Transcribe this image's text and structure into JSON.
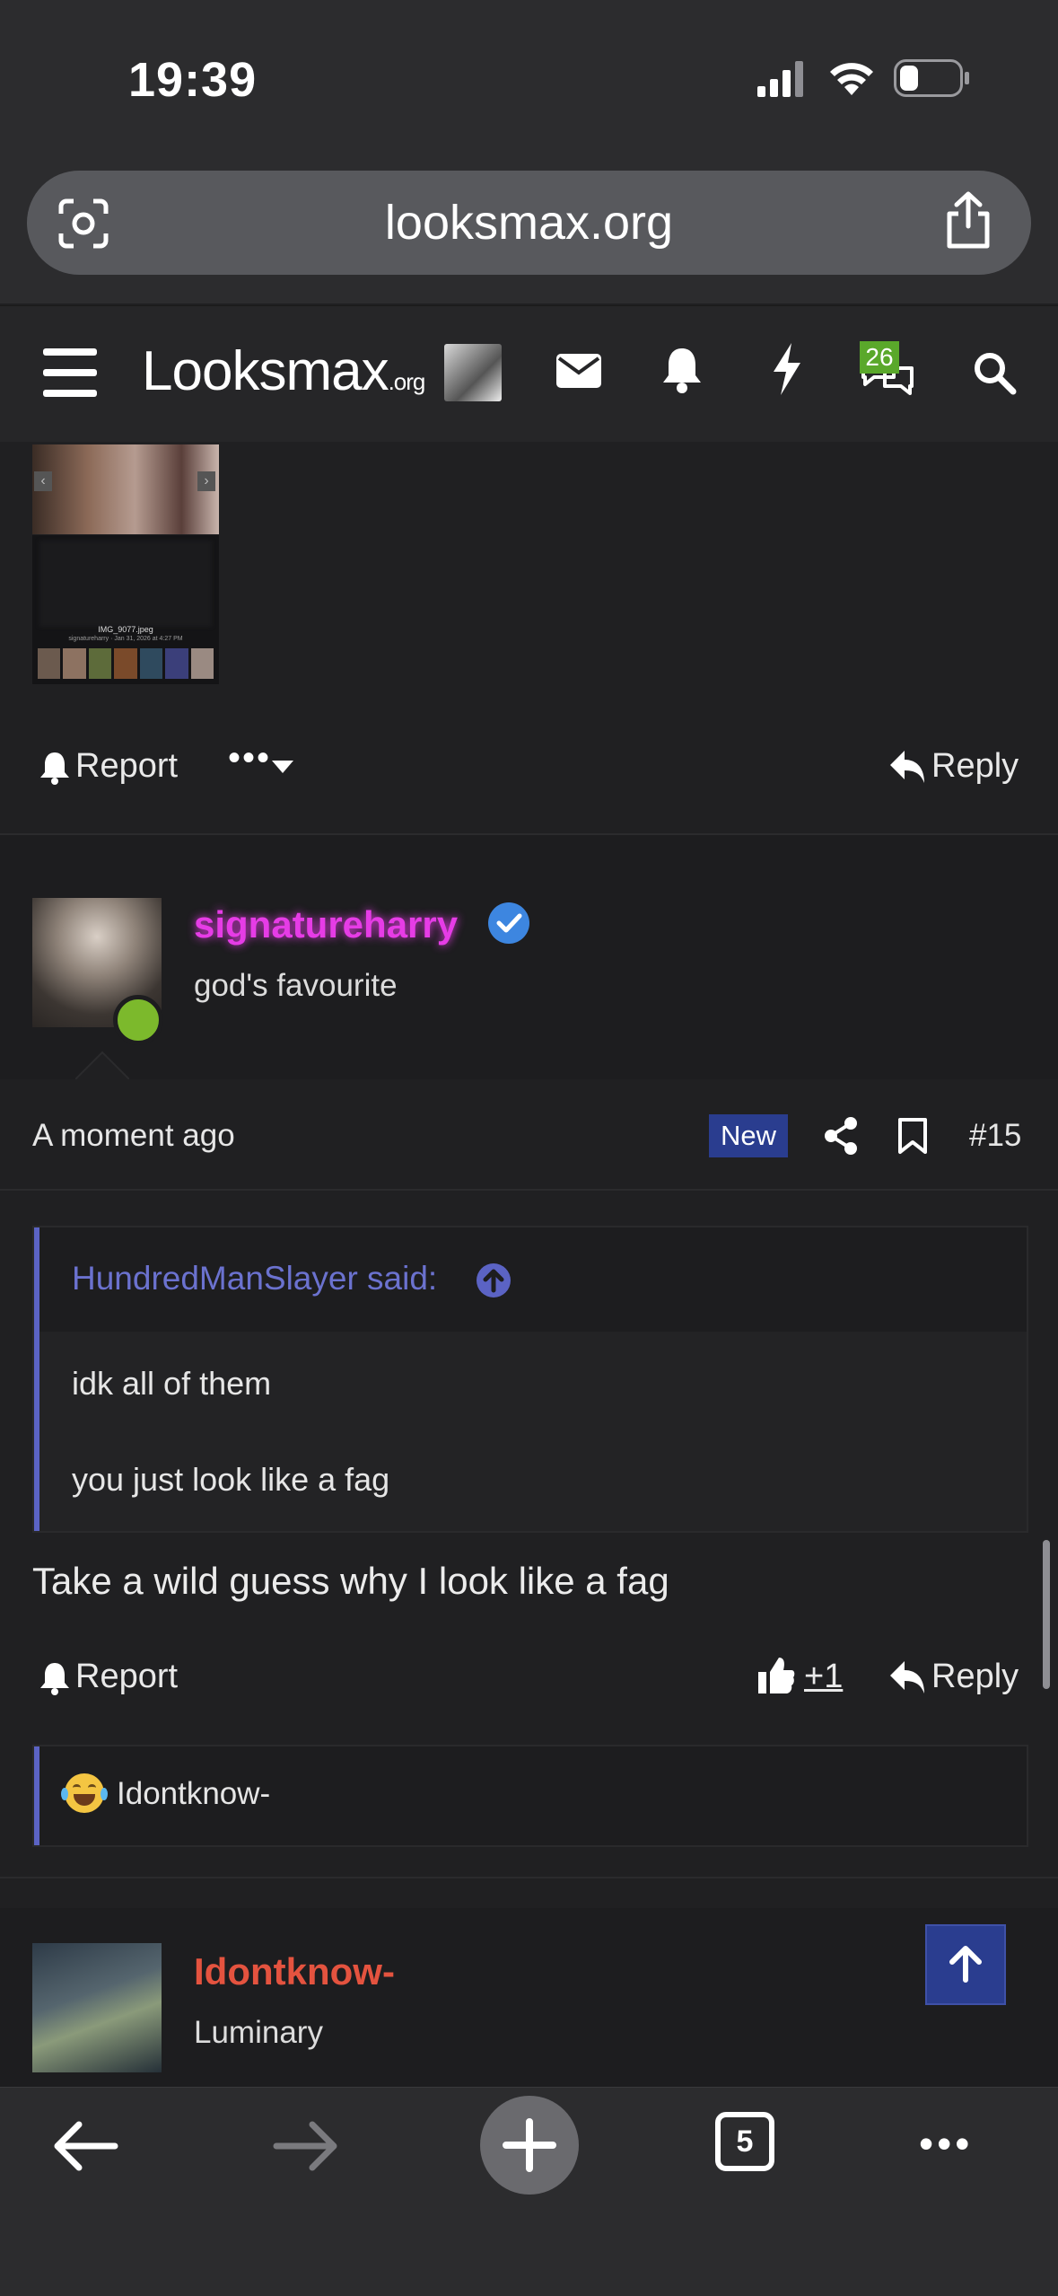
{
  "status_bar": {
    "time": "19:39"
  },
  "browser": {
    "url": "looksmax.org",
    "tab_count": "5"
  },
  "site_header": {
    "logo_main": "Looksmax",
    "logo_suffix": ".org",
    "conversations_badge": "26"
  },
  "prev_post": {
    "attachment_caption": "IMG_9077.jpeg",
    "attachment_meta": "signatureharry · Jan 31, 2026 at 4:27 PM",
    "report_label": "Report",
    "reply_label": "Reply"
  },
  "post": {
    "username": "signatureharry",
    "user_title": "god's favourite",
    "timestamp": "A moment ago",
    "new_badge": "New",
    "post_number": "#15",
    "quote_author": "HundredManSlayer said:",
    "quote_line1": "idk all of them",
    "quote_line2": "you just look like a fag",
    "body": "Take a wild guess why I look like a fag",
    "report_label": "Report",
    "like_count": "+1",
    "reply_label": "Reply",
    "reaction_user": "Idontknow-"
  },
  "next_post": {
    "username": "Idontknow-",
    "user_title": "Luminary"
  },
  "colors": {
    "username_pink": "#e63ce6",
    "username_red": "#e4533f",
    "quote_accent": "#5b63c4",
    "new_badge_bg": "#2a3d8f",
    "online_dot": "#7cb92c",
    "verified_blue": "#3d86e0"
  }
}
